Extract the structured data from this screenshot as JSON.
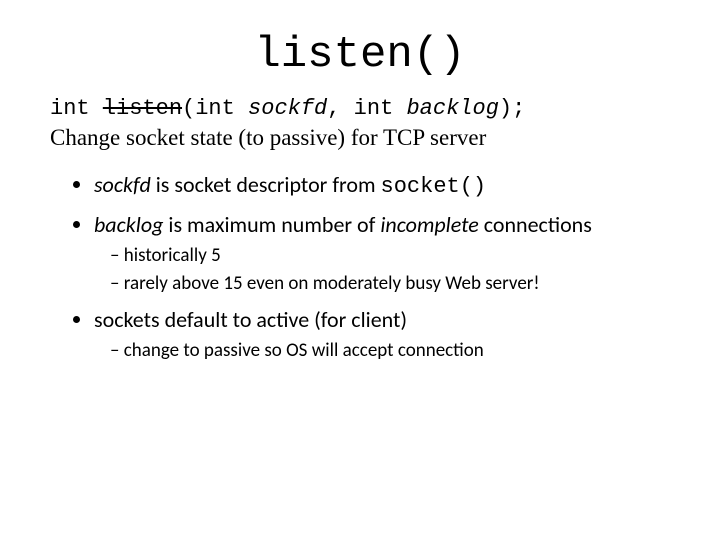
{
  "title": "listen()",
  "signature": {
    "ret": "int ",
    "fname": "listen",
    "paren_open": "(",
    "param1_type": "int ",
    "param1_name": "sockfd",
    "comma": ", ",
    "param2_type": "int ",
    "param2_name": "backlog",
    "paren_close": ");"
  },
  "description": "Change socket state (to passive) for TCP server",
  "bullets": {
    "b1_a": "sockfd",
    "b1_b": " is socket descriptor from ",
    "b1_c": "socket()",
    "b2_a": "backlog",
    "b2_b": " is maximum number of ",
    "b2_c": "incomplete",
    "b2_d": " connections",
    "b2_sub1": "historically 5",
    "b2_sub2": "rarely above 15 even on moderately busy Web server!",
    "b3": "sockets default to active (for client)",
    "b3_sub1": "change to passive so OS will accept connection"
  }
}
